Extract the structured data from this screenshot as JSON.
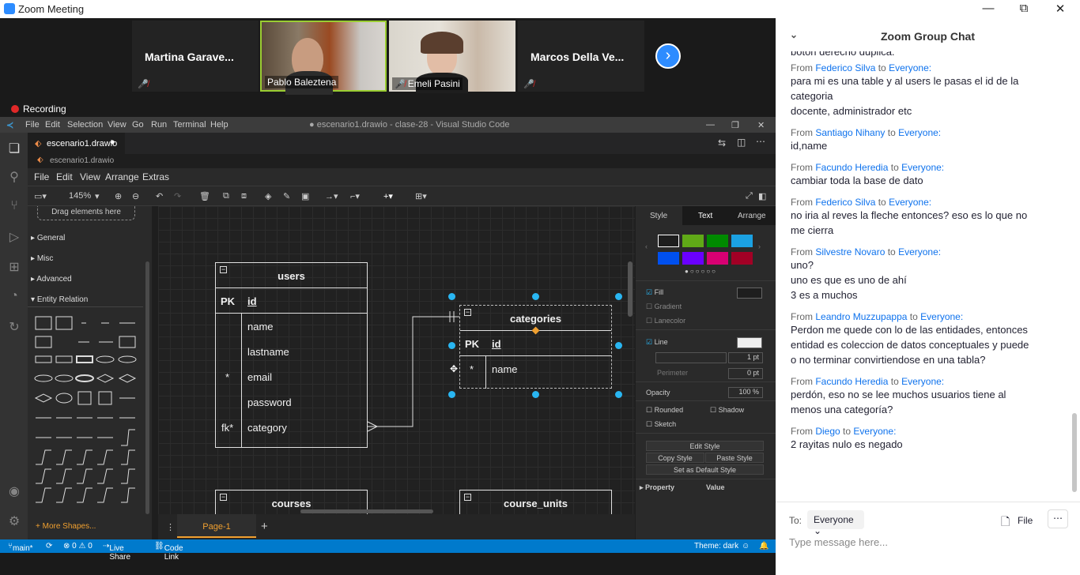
{
  "window": {
    "title": "Zoom Meeting",
    "min": "—",
    "restore": "⧉",
    "close": "✕"
  },
  "participants": [
    {
      "name": "Martina  Garave...",
      "muted": true
    },
    {
      "name": "Pablo Baleztena",
      "muted": false
    },
    {
      "name": "Emeli Pasini",
      "muted": true
    },
    {
      "name": "Marcos  Della  Ve...",
      "muted": true
    }
  ],
  "recording": "Recording",
  "vscode": {
    "menu": [
      "File",
      "Edit",
      "Selection",
      "View",
      "Go",
      "Run",
      "Terminal",
      "Help"
    ],
    "window_title": "● escenario1.drawio - clase-28 - Visual Studio Code",
    "tab": "escenario1.drawio",
    "breadcrumb": "escenario1.drawio",
    "status": {
      "branch": "main*",
      "problems": "⊗ 0 ⚠ 0",
      "liveshare": "Live Share",
      "codelink": "Code Link",
      "theme": "Theme: dark"
    }
  },
  "drawio": {
    "menu": [
      "File",
      "Edit",
      "View",
      "Arrange",
      "Extras"
    ],
    "zoom": "145%",
    "sidebar": {
      "drag_hint": "Drag elements here",
      "sections": [
        "General",
        "Misc",
        "Advanced",
        "Entity Relation"
      ],
      "more_shapes": "More Shapes..."
    },
    "page_tab": "Page-1",
    "format": {
      "tabs": [
        "Style",
        "Text",
        "Arrange"
      ],
      "fill": "Fill",
      "gradient": "Gradient",
      "lanecolor": "Lanecolor",
      "line": "Line",
      "line_width": "1 pt",
      "perimeter": "Perimeter",
      "perimeter_val": "0 pt",
      "opacity": "Opacity",
      "opacity_val": "100 %",
      "rounded": "Rounded",
      "shadow": "Shadow",
      "sketch": "Sketch",
      "edit_style": "Edit Style",
      "copy_style": "Copy Style",
      "paste_style": "Paste Style",
      "default_style": "Set as Default Style",
      "property": "Property",
      "value": "Value",
      "swatches": [
        "#ffffff",
        "#60a917",
        "#008a00",
        "#1ba1e2",
        "#0050ef",
        "#6a00ff",
        "#d80073",
        "#a20025"
      ]
    },
    "tables": {
      "users": {
        "title": "users",
        "rows": [
          [
            "PK",
            "id"
          ],
          [
            "",
            "name"
          ],
          [
            "",
            "lastname"
          ],
          [
            "*",
            "email"
          ],
          [
            "",
            "password"
          ],
          [
            "fk*",
            "category"
          ]
        ]
      },
      "categories": {
        "title": "categories",
        "rows": [
          [
            "PK",
            "id"
          ],
          [
            "*",
            "name"
          ]
        ]
      },
      "courses": {
        "title": "courses"
      },
      "course_units": {
        "title": "course_units"
      }
    }
  },
  "chat": {
    "title": "Zoom Group Chat",
    "clipped_top": "botón derecho duplica.",
    "messages": [
      {
        "from": "Federico Silva",
        "to": "Everyone:",
        "lines": [
          "para mi es una table y al users le pasas el id de la",
          "categoria",
          "docente, administrador etc"
        ]
      },
      {
        "from": "Santiago Nihany",
        "to": "Everyone:",
        "lines": [
          "id,name"
        ]
      },
      {
        "from": "Facundo Heredia",
        "to": "Everyone:",
        "lines": [
          "cambiar toda la base de dato"
        ]
      },
      {
        "from": "Federico Silva",
        "to": "Everyone:",
        "lines": [
          "no iria al reves la fleche entonces? eso es lo que no",
          "me cierra"
        ]
      },
      {
        "from": "Silvestre Novaro",
        "to": "Everyone:",
        "lines": [
          "uno?",
          "uno es que es uno de ahí",
          "3 es a muchos"
        ]
      },
      {
        "from": "Leandro Muzzupappa",
        "to": "Everyone:",
        "lines": [
          "Perdon me quede con lo de las entidades, entonces",
          "entidad es coleccion de datos conceptuales y puede",
          "o no terminar convirtiendose en una tabla?"
        ]
      },
      {
        "from": "Facundo Heredia",
        "to": "Everyone:",
        "lines": [
          "perdón, eso no se lee muchos usuarios tiene al",
          "menos una categoría?"
        ]
      },
      {
        "from": "Diego",
        "to": "Everyone:",
        "lines": [
          "2 rayitas nulo es negado"
        ]
      }
    ],
    "from_word": "From",
    "to_word": "to",
    "to_label": "To:",
    "recipient": "Everyone",
    "file_label": "File",
    "placeholder": "Type message here..."
  }
}
